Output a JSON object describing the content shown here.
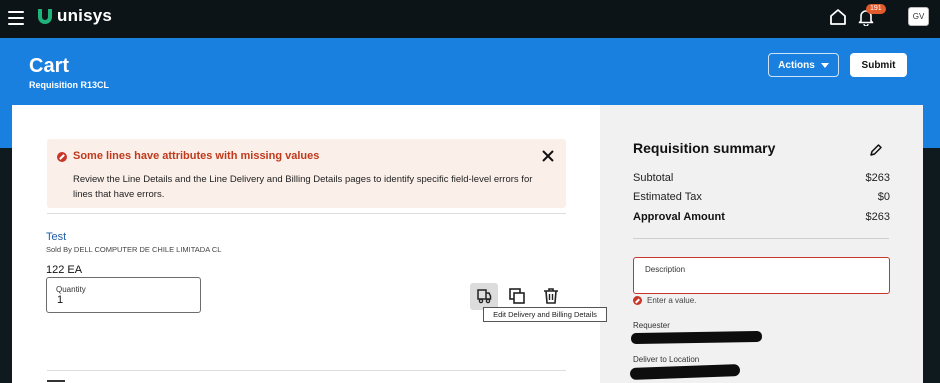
{
  "app": {
    "brand": "unisys",
    "notification_count": "191",
    "user_initials": "GV"
  },
  "header": {
    "title": "Cart",
    "subtitle": "Requisition R13CL",
    "actions_label": "Actions",
    "submit_label": "Submit"
  },
  "error_banner": {
    "title": "Some lines have attributes with missing values",
    "body": "Review the Line Details and the Line Delivery and Billing Details pages to identify specific field-level errors for lines that have errors."
  },
  "line_item": {
    "name": "Test",
    "sold_by": "Sold By DELL COMPUTER DE CHILE LIMITADA CL",
    "quantity_text": "122 EA",
    "quantity_label": "Quantity",
    "quantity_value": "1",
    "tooltip": "Edit Delivery and Billing Details"
  },
  "summary": {
    "title": "Requisition summary",
    "rows": [
      {
        "label": "Subtotal",
        "value": "$263"
      },
      {
        "label": "Estimated Tax",
        "value": "$0"
      },
      {
        "label": "Approval Amount",
        "value": "$263"
      }
    ],
    "description_label": "Description",
    "description_error": "Enter a value.",
    "requester_label": "Requester",
    "deliver_label": "Deliver to Location"
  },
  "colors": {
    "topbar": "#0c1418",
    "header_blue": "#1a80e0",
    "brand_green": "#1fb37a",
    "error_red": "#c7362a",
    "badge_orange": "#e35a2b"
  }
}
